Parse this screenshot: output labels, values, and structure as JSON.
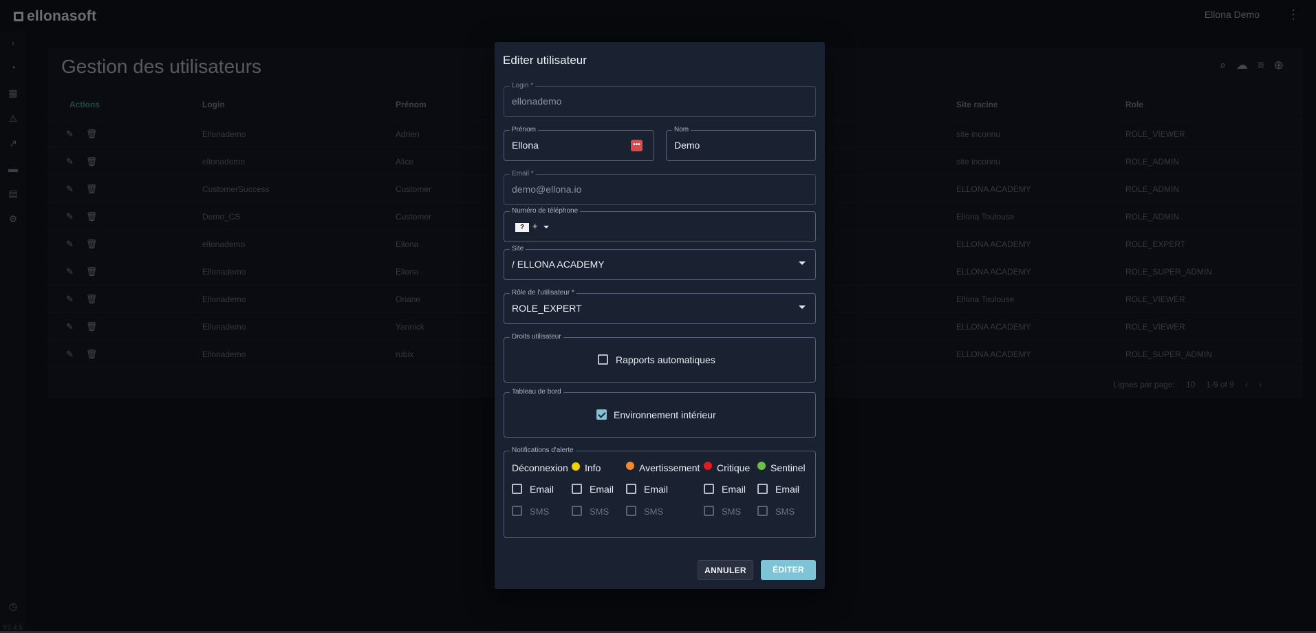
{
  "app": {
    "logo": "ellonasoft",
    "user": "Ellona Demo",
    "version": "V2.4.5"
  },
  "page": {
    "title": "Gestion des utilisateurs",
    "columns": [
      "Actions",
      "Login",
      "Prénom",
      "Site racine",
      "Role"
    ],
    "rows": [
      {
        "login": "Ellonademo",
        "prenom": "Adrien",
        "site": "site inconnu",
        "role": "ROLE_VIEWER"
      },
      {
        "login": "ellonademo",
        "prenom": "Alice",
        "site": "site inconnu",
        "role": "ROLE_ADMIN"
      },
      {
        "login": "CustomerSuccess",
        "prenom": "Customer",
        "site": "ELLONA ACADEMY",
        "role": "ROLE_ADMIN"
      },
      {
        "login": "Demo_CS",
        "prenom": "Customer",
        "site": "Ellona Toulouse",
        "role": "ROLE_ADMIN"
      },
      {
        "login": "ellonademo",
        "prenom": "Ellona",
        "site": "ELLONA ACADEMY",
        "role": "ROLE_EXPERT"
      },
      {
        "login": "Ellonademo",
        "prenom": "Ellona",
        "site": "ELLONA ACADEMY",
        "role": "ROLE_SUPER_ADMIN"
      },
      {
        "login": "Ellonademo",
        "prenom": "Oriane",
        "site": "Ellona Toulouse",
        "role": "ROLE_VIEWER"
      },
      {
        "login": "Ellonademo",
        "prenom": "Yannick",
        "site": "ELLONA ACADEMY",
        "role": "ROLE_VIEWER"
      },
      {
        "login": "Ellonademo",
        "prenom": "rubix",
        "site": "ELLONA ACADEMY",
        "role": "ROLE_SUPER_ADMIN"
      }
    ],
    "pager": {
      "label": "Lignes par page:",
      "per_page": "10",
      "range": "1-9 of 9"
    }
  },
  "dialog": {
    "title": "Editer utilisateur",
    "login": {
      "label": "Login *",
      "value": "ellonademo"
    },
    "prenom": {
      "label": "Prénom",
      "value": "Ellona"
    },
    "nom": {
      "label": "Nom",
      "value": "Demo"
    },
    "email": {
      "label": "Email *",
      "value": "demo@ellona.io"
    },
    "phone": {
      "label": "Numéro de téléphone",
      "flag": "?",
      "prefix": "+"
    },
    "site": {
      "label": "Site",
      "value": "/ ELLONA ACADEMY"
    },
    "role": {
      "label": "Rôle de l'utilisateur *",
      "value": "ROLE_EXPERT"
    },
    "droits": {
      "label": "Droits utilisateur",
      "option": "Rapports automatiques",
      "checked": false
    },
    "tableau": {
      "label": "Tableau de bord",
      "option": "Environnement intérieur",
      "checked": true
    },
    "notifications": {
      "label": "Notifications d'alerte",
      "columns": [
        {
          "name": "Déconnexion",
          "color": ""
        },
        {
          "name": "Info",
          "color": "#f5d100"
        },
        {
          "name": "Avertissement",
          "color": "#ef8a2e"
        },
        {
          "name": "Critique",
          "color": "#e31b1b"
        },
        {
          "name": "Sentinel",
          "color": "#6cc04a"
        }
      ],
      "email_label": "Email",
      "sms_label": "SMS"
    },
    "buttons": {
      "cancel": "ANNULER",
      "submit": "ÉDITER"
    }
  }
}
